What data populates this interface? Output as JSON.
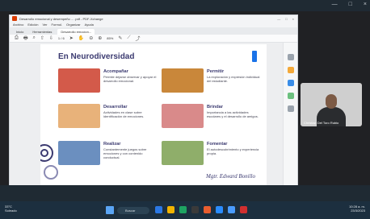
{
  "window": {
    "title": "Desarrollo emocional y desempeño ... .pdf - PDF-Xchange",
    "controls": [
      "—",
      "□",
      "×"
    ]
  },
  "menu": [
    "Archivo",
    "Edición",
    "Ver",
    "Formul.",
    "Organizar",
    "Ayuda"
  ],
  "tabs": [
    {
      "label": "Inicio"
    },
    {
      "label": "Herramientas"
    },
    {
      "label": "Desarrollo emocion...",
      "active": true
    }
  ],
  "toolbar": {
    "page_indicator": "1 / 6",
    "zoom_level": "85%",
    "icons": [
      "save-icon",
      "print-icon",
      "search-icon",
      "prev-page-icon",
      "next-page-icon",
      "cursor-icon",
      "hand-icon",
      "zoom-out-icon",
      "zoom-in-icon",
      "comment-icon",
      "draw-icon",
      "share-icon"
    ]
  },
  "document": {
    "title": "En Neurodiversidad",
    "signature": "Mgtr. Edward Bonillo",
    "items": [
      {
        "heading": "Acompañar",
        "text": "Permite dejarse observar y apoyar el desarrollo emocional.",
        "color": "#d35a4a"
      },
      {
        "heading": "Permitir",
        "text": "La exploración y expresión individual del estudiante.",
        "color": "#c9873a"
      },
      {
        "heading": "Desarrollar",
        "text": "Actividades en clase sobre identificación de emociones.",
        "color": "#e8b27a"
      },
      {
        "heading": "Brindar",
        "text": "Importancia a las actividades escolares y el desarrollo de amigos.",
        "color": "#d98a8a"
      },
      {
        "heading": "Realizar",
        "text": "Constantemente juegos sobre emociones y con contenido conductual.",
        "color": "#6b8fbf"
      },
      {
        "heading": "Fomentar",
        "text": "El autodescubrimiento y experiencia propia.",
        "color": "#8fae6a"
      }
    ]
  },
  "participant": {
    "name": "Christian Del Toro Rubio"
  },
  "taskbar": {
    "weather_line1": "33°C",
    "weather_line2": "Soleado",
    "search_placeholder": "Buscar",
    "app_colors": [
      "#2b78e4",
      "#f2b400",
      "#1ea362",
      "#3a3a3a",
      "#e85d2f",
      "#2a8cff",
      "#4a9cff",
      "#d12f2f"
    ],
    "time": "10:28 a. m.",
    "date": "23/3/2023"
  },
  "colors": {
    "title_color": "#3b3a70",
    "meet_bg": "#202124",
    "taskbar_bg": "#1c2f3f"
  }
}
